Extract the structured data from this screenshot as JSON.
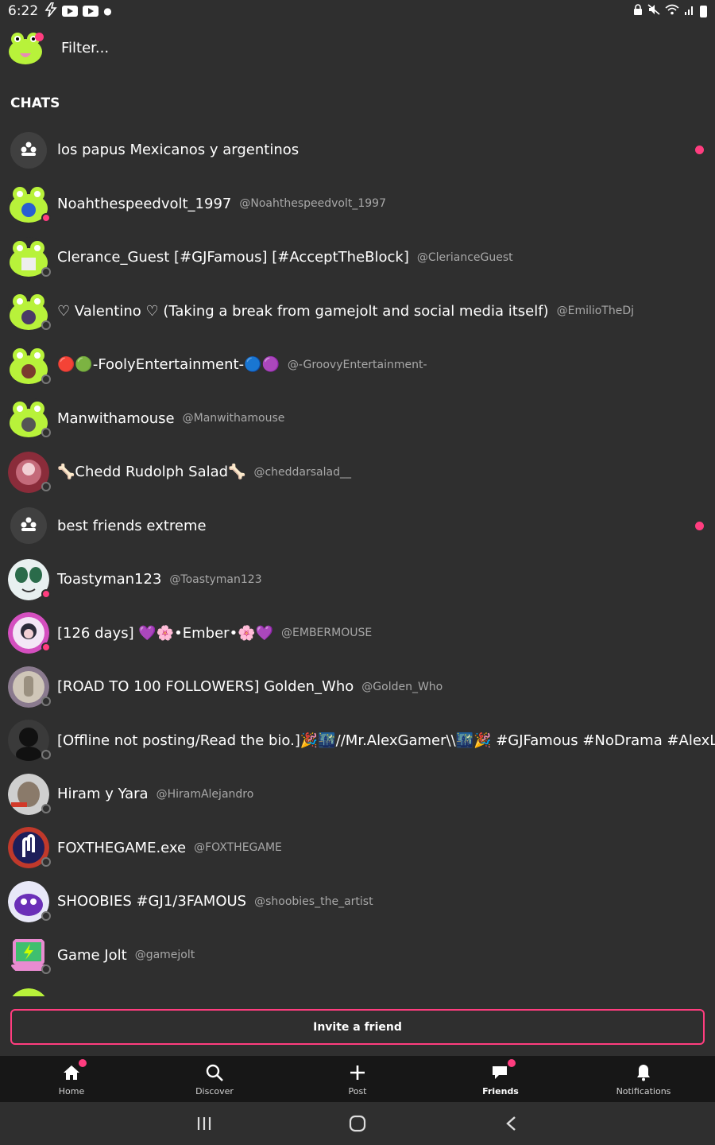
{
  "status_bar": {
    "time": "6:22",
    "left_icons": [
      "lightning-icon",
      "youtube-icon",
      "youtube-icon",
      "dot-icon"
    ],
    "right_icons": [
      "lock-icon",
      "mute-icon",
      "wifi-icon",
      "signal-icon",
      "battery-icon"
    ]
  },
  "header": {
    "filter_placeholder": "Filter..."
  },
  "chats": {
    "section_title": "CHATS",
    "items": [
      {
        "name": "los papus Mexicanos y argentinos",
        "handle": "",
        "type": "group",
        "unread": true
      },
      {
        "name": "Noahthespeedvolt_1997",
        "handle": "@Noahthespeedvolt_1997",
        "type": "user",
        "presence": "online"
      },
      {
        "name": "Clerance_Guest [#GJFamous] [#AcceptTheBlock]",
        "handle": "@ClerianceGuest",
        "type": "user",
        "presence": "offline"
      },
      {
        "name": "♡ Valentino ♡ (Taking a break from gamejolt and social media itself)",
        "handle": "@EmilioTheDj",
        "type": "user",
        "presence": "offline"
      },
      {
        "name": "🔴🟢-FoolyEntertainment-🔵🟣",
        "handle": "@-GroovyEntertainment-",
        "type": "user",
        "presence": "offline"
      },
      {
        "name": "Manwithamouse",
        "handle": "@Manwithamouse",
        "type": "user",
        "presence": "offline"
      },
      {
        "name": "🦴Chedd Rudolph Salad🦴",
        "handle": "@cheddarsalad__",
        "type": "user",
        "presence": "offline"
      },
      {
        "name": "best friends extreme",
        "handle": "",
        "type": "group",
        "unread": true
      },
      {
        "name": "Toastyman123",
        "handle": "@Toastyman123",
        "type": "user",
        "presence": "online"
      },
      {
        "name": "[126 days] 💜🌸•Ember•🌸💜",
        "handle": "@EMBERMOUSE",
        "type": "user",
        "presence": "online"
      },
      {
        "name": "[ROAD TO 100 FOLLOWERS] Golden_Who",
        "handle": "@Golden_Who",
        "type": "user",
        "presence": "offline"
      },
      {
        "name": "[Offline not posting/Read the bio.]🎉🌃//Mr.AlexGamer\\\\🌃🎉 #GJFamous #NoDrama #AlexLive",
        "handle": "",
        "type": "user",
        "presence": "offline"
      },
      {
        "name": "Hiram y Yara",
        "handle": "@HiramAlejandro",
        "type": "user",
        "presence": "offline"
      },
      {
        "name": "FOXTHEGAME.exe",
        "handle": "@FOXTHEGAME",
        "type": "user",
        "presence": "offline"
      },
      {
        "name": "SHOOBIES #GJ1/3FAMOUS",
        "handle": "@shoobies_the_artist",
        "type": "user",
        "presence": "offline"
      },
      {
        "name": "Game Jolt",
        "handle": "@gamejolt",
        "type": "user",
        "presence": "offline"
      }
    ]
  },
  "invite": {
    "label": "Invite a friend"
  },
  "bottom_nav": {
    "items": [
      {
        "label": "Home",
        "icon": "home-icon",
        "badge": true,
        "active": false
      },
      {
        "label": "Discover",
        "icon": "search-icon",
        "badge": false,
        "active": false
      },
      {
        "label": "Post",
        "icon": "plus-icon",
        "badge": false,
        "active": false
      },
      {
        "label": "Friends",
        "icon": "chat-bubbles-icon",
        "badge": true,
        "active": true
      },
      {
        "label": "Notifications",
        "icon": "bell-icon",
        "badge": false,
        "active": false
      }
    ]
  },
  "colors": {
    "background": "#2f2f2f",
    "accent": "#ff3d7f",
    "nav_background": "#171717",
    "avatar_green": "#b8f23a"
  }
}
